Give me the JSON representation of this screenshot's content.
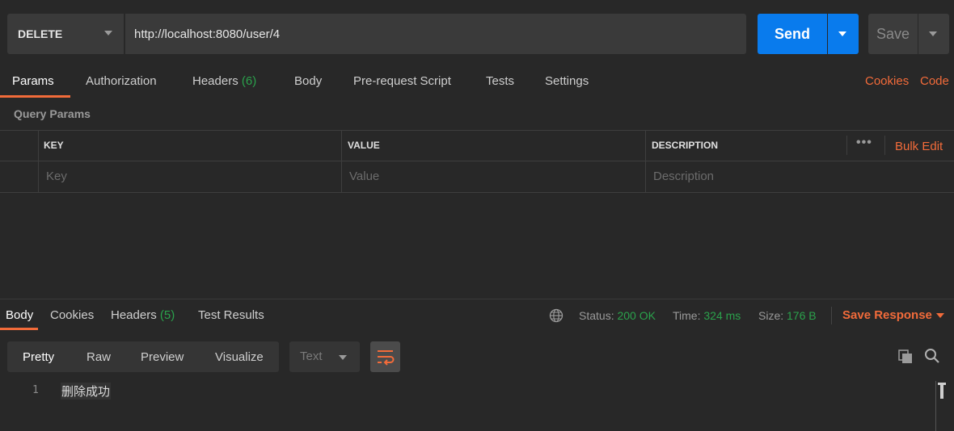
{
  "request": {
    "method": "DELETE",
    "url": "http://localhost:8080/user/4",
    "send_label": "Send",
    "save_label": "Save"
  },
  "request_tabs": {
    "params": "Params",
    "authorization": "Authorization",
    "headers": "Headers",
    "headers_count": "(6)",
    "body": "Body",
    "pre_request_script": "Pre-request Script",
    "tests": "Tests",
    "settings": "Settings",
    "cookies": "Cookies",
    "code": "Code"
  },
  "query_params": {
    "title": "Query Params",
    "columns": {
      "key": "KEY",
      "value": "VALUE",
      "description": "DESCRIPTION"
    },
    "more": "•••",
    "bulk_edit": "Bulk Edit",
    "placeholders": {
      "key": "Key",
      "value": "Value",
      "description": "Description"
    }
  },
  "response_tabs": {
    "body": "Body",
    "cookies": "Cookies",
    "headers": "Headers",
    "headers_count": "(5)",
    "test_results": "Test Results"
  },
  "response_status": {
    "status_label": "Status:",
    "status_value": "200 OK",
    "time_label": "Time:",
    "time_value": "324 ms",
    "size_label": "Size:",
    "size_value": "176 B",
    "save_response": "Save Response"
  },
  "response_view": {
    "formats": {
      "pretty": "Pretty",
      "raw": "Raw",
      "preview": "Preview",
      "visualize": "Visualize"
    },
    "language": "Text"
  },
  "response_body": {
    "lines": [
      {
        "number": "1",
        "text": "删除成功"
      }
    ]
  },
  "colors": {
    "accent": "#f26b3a",
    "primary": "#097bed",
    "success": "#2ba24c",
    "background": "#282828"
  }
}
